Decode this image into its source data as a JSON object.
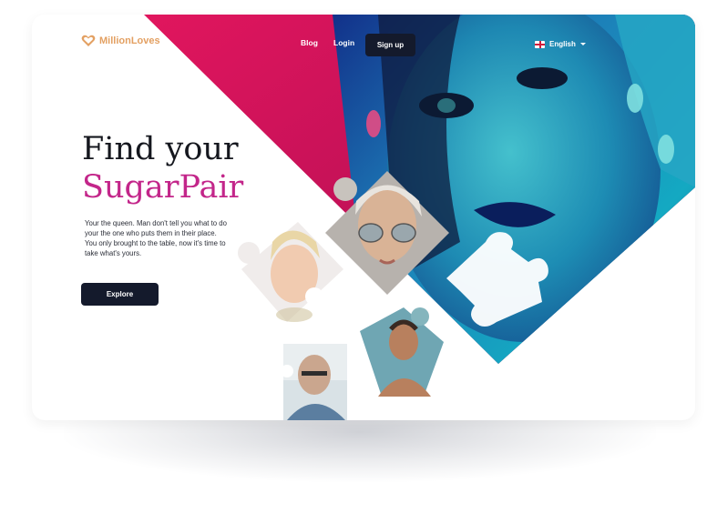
{
  "brand": {
    "name": "MillionLoves",
    "color": "#e3a062",
    "icon": "heart-logo-icon"
  },
  "nav": {
    "blog": "Blog",
    "login": "Login",
    "signup": "Sign up",
    "language": "English",
    "flag_icon": "uk-flag-icon"
  },
  "hero": {
    "title_line1": "Find your",
    "title_line2": "SugarPair",
    "accent_color": "#c3268a",
    "description": "Your the queen. Man don't tell you what to do your the one who puts them in their place. You only brought to the table, now it's time to take what's yours.",
    "cta": "Explore"
  },
  "images": [
    "neon-portrait-woman",
    "puzzle-piece-woman-sunglasses",
    "puzzle-piece-blonde-woman",
    "puzzle-piece-man-glasses",
    "puzzle-piece-shirtless-man",
    "puzzle-piece-empty"
  ],
  "colors": {
    "dark_button": "#141a2c",
    "magenta": "#d6145f",
    "teal": "#1ba7c0"
  }
}
